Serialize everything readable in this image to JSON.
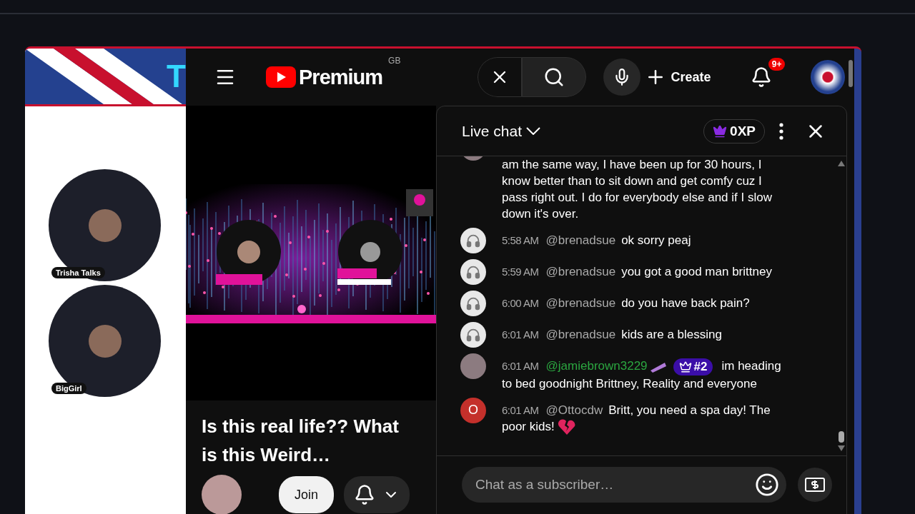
{
  "stream_overlay": {
    "banner_text": "T",
    "speakers": [
      {
        "name": "Trisha Talks"
      },
      {
        "name": "BigGirl"
      }
    ]
  },
  "header": {
    "brand": "Premium",
    "region": "GB",
    "create_label": "Create",
    "notification_count": "9+"
  },
  "video": {
    "title": "Is this real life?? What is this Weird…",
    "join_label": "Join"
  },
  "chat": {
    "title": "Live chat",
    "xp": "0XP",
    "messages": [
      {
        "kind": "continuation",
        "avatar": {
          "kind": "photo"
        },
        "text": "am the same way, I have been up for 30 hours, I know better than to sit down and get comfy cuz I pass right out. I do for everybody else and if I slow down it's over."
      },
      {
        "kind": "viewer",
        "avatar": {
          "kind": "headphones"
        },
        "time": "5:58 AM",
        "author": "@brenadsue",
        "text": "ok sorry peaj"
      },
      {
        "kind": "viewer",
        "avatar": {
          "kind": "headphones"
        },
        "time": "5:59 AM",
        "author": "@brenadsue",
        "text": "you got a good man brittney"
      },
      {
        "kind": "viewer",
        "avatar": {
          "kind": "headphones"
        },
        "time": "6:00 AM",
        "author": "@brenadsue",
        "text": "do you have back pain?"
      },
      {
        "kind": "viewer",
        "avatar": {
          "kind": "headphones"
        },
        "time": "6:01 AM",
        "author": "@brenadsue",
        "text": "kids are a blessing"
      },
      {
        "kind": "member",
        "avatar": {
          "kind": "photo"
        },
        "time": "6:01 AM",
        "author": "@jamiebrown3229",
        "member_sticker": true,
        "rank": "#2",
        "text": "im heading to bed goodnight Brittney, Reality and everyone"
      },
      {
        "kind": "viewer",
        "avatar": {
          "kind": "letter",
          "letter": "O",
          "color": "#c4302b"
        },
        "time": "6:01 AM",
        "author": "@Ottocdw",
        "text": "Britt, you need a spa day! The poor kids!",
        "heart": true
      }
    ],
    "input": {
      "placeholder": "Chat as a subscriber…"
    }
  }
}
